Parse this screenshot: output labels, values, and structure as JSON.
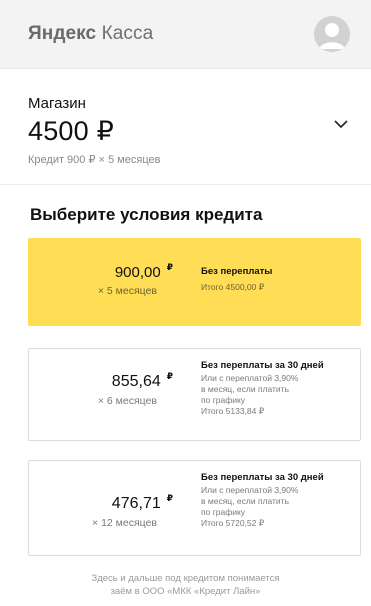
{
  "header": {
    "brand_bold": "Яндекс",
    "brand_regular": "Касса",
    "avatar_icon": "user-avatar-icon"
  },
  "order": {
    "shop_label": "Магазин",
    "amount": "4500 ₽",
    "credit_line": "Кредит 900 ₽ × 5 месяцев",
    "expand_icon": "chevron-down-icon"
  },
  "conditions": {
    "title": "Выберите условия кредита",
    "options": [
      {
        "amount": "900,00",
        "currency": "₽",
        "months": "× 5 месяцев",
        "title": "Без переплаты",
        "description": "",
        "total": "Итого  4500,00 ₽",
        "selected": true
      },
      {
        "amount": "855,64",
        "currency": "₽",
        "months": "× 6 месяцев",
        "title": "Без переплаты за 30 дней",
        "description_lines": [
          "Или с переплатой 3,90%",
          "в месяц, если платить",
          "по графику"
        ],
        "total": "Итого  5133,84 ₽",
        "selected": false
      },
      {
        "amount": "476,71",
        "currency": "₽",
        "months": "× 12 месяцев",
        "title": "Без переплаты за 30 дней",
        "description_lines": [
          "Или с переплатой 3,90%",
          "в месяц, если платить",
          "по графику"
        ],
        "total": "Итого  5720,52 ₽",
        "selected": false
      }
    ]
  },
  "footer": {
    "line1": "Здесь и дальше под кредитом понимается",
    "line2": "заём в ООО «МКК «Кредит Лайн»"
  },
  "colors": {
    "accent_yellow": "#ffdd55",
    "header_bg": "#f3f3f3"
  }
}
